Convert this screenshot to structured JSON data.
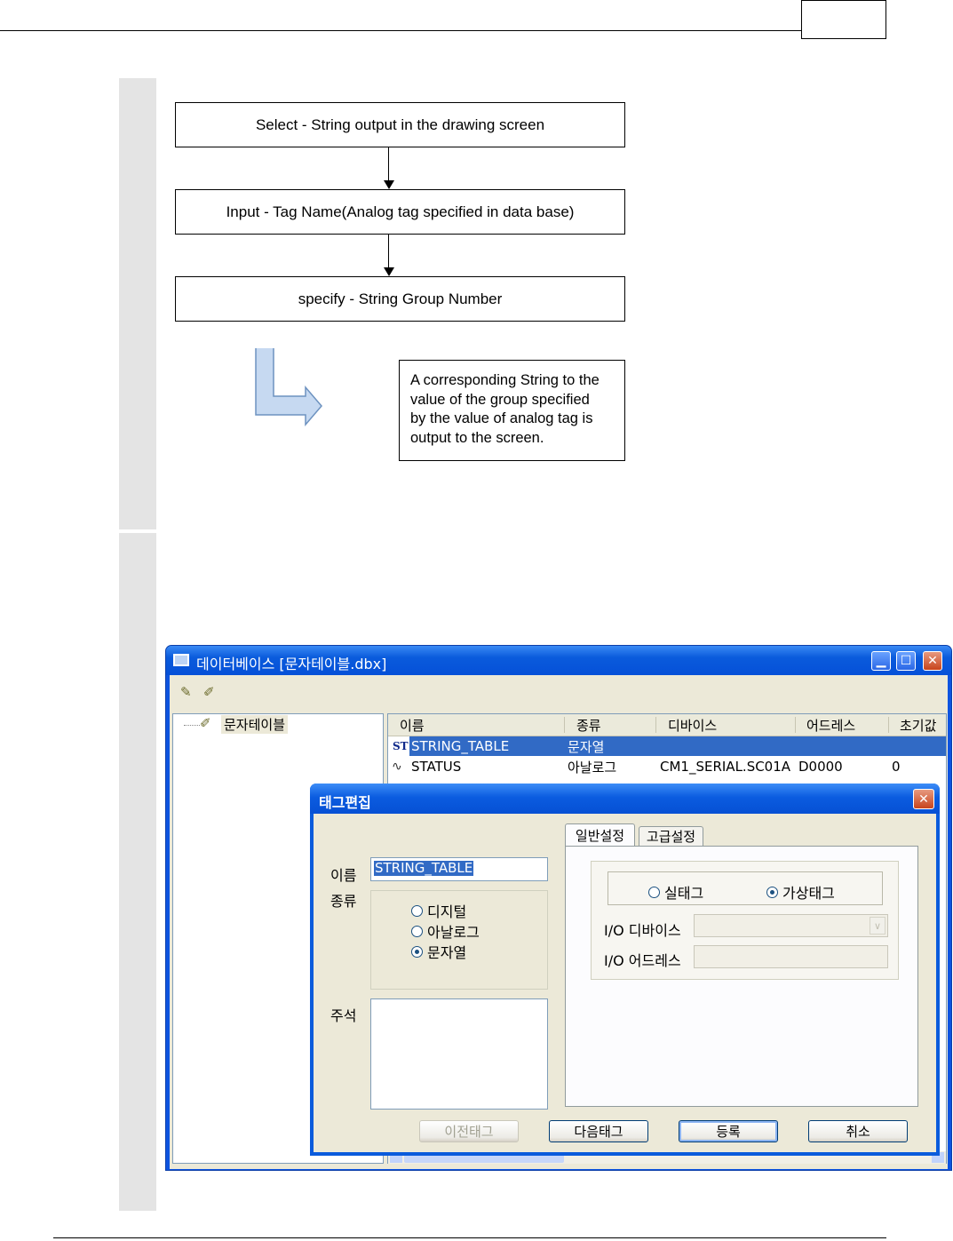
{
  "flow": {
    "step1": "Select -  String output in the drawing screen",
    "step2": "Input - Tag Name(Analog tag specified in data base)",
    "step3": "specify - String Group Number",
    "result": [
      "A corresponding String to the",
      "value of the group specified",
      "by the value of analog tag is",
      "output to the screen."
    ]
  },
  "window": {
    "title": "데이터베이스 [문자테이블.dbx]",
    "tree_root": "문자테이블",
    "columns": [
      "이름",
      "종류",
      "디바이스",
      "어드레스",
      "초기값"
    ],
    "rows": [
      {
        "icon": "ST",
        "name": "STRING_TABLE",
        "type": "문자열",
        "device": "",
        "address": "",
        "initial": ""
      },
      {
        "icon": "analog",
        "name": "STATUS",
        "type": "아날로그",
        "device": "CM1_SERIAL.SC01A",
        "address": "D0000",
        "initial": "0"
      }
    ],
    "selection_color": "#316ac5",
    "titlebar_color": "#0a5bdc"
  },
  "dialog": {
    "title": "태그편집",
    "name_label": "이름",
    "name_value": "STRING_TABLE",
    "type_label": "종류",
    "type_options": [
      {
        "label": "디지털",
        "selected": false
      },
      {
        "label": "아날로그",
        "selected": false
      },
      {
        "label": "문자열",
        "selected": true
      }
    ],
    "comment_label": "주석",
    "tabs": [
      "일반설정",
      "고급설정"
    ],
    "active_tab": "일반설정",
    "tag_kind_options": [
      {
        "label": "실태그",
        "selected": false
      },
      {
        "label": "가상태그",
        "selected": true
      }
    ],
    "io_device_label": "I/O 디바이스",
    "io_address_label": "I/O 어드레스",
    "buttons": {
      "prev": "이전태그",
      "next": "다음태그",
      "register": "등록",
      "cancel": "취소"
    }
  }
}
